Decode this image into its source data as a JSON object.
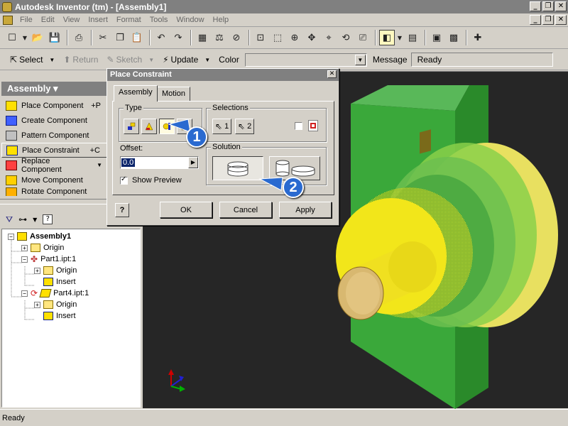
{
  "window": {
    "title": "Autodesk Inventor (tm) - [Assembly1]",
    "controls": [
      "_",
      "❐",
      "✕"
    ]
  },
  "menubar": {
    "items": [
      "File",
      "Edit",
      "View",
      "Insert",
      "Format",
      "Tools",
      "Window",
      "Help"
    ]
  },
  "toolbar": {
    "icons": [
      "new-icon",
      "open-icon",
      "save-icon",
      "print-icon",
      "cut-icon",
      "copy-icon",
      "paste-icon",
      "undo-icon",
      "redo-icon"
    ]
  },
  "command_bar": {
    "select_label": "Select",
    "return_label": "Return",
    "sketch_label": "Sketch",
    "update_label": "Update",
    "color_label": "Color",
    "color_value": "",
    "message_label": "Message",
    "message_value": "Ready"
  },
  "panel": {
    "header": "Assembly ▾",
    "items": [
      {
        "label": "Place Component",
        "shortcut": "+P"
      },
      {
        "label": "Create Component",
        "shortcut": ""
      },
      {
        "label": "Pattern Component",
        "shortcut": ""
      },
      {
        "label": "Place Constraint",
        "shortcut": "+C"
      },
      {
        "label": "Replace Component",
        "shortcut": ""
      },
      {
        "label": "Move Component",
        "shortcut": ""
      },
      {
        "label": "Rotate Component",
        "shortcut": ""
      }
    ]
  },
  "tree": {
    "root": "Assembly1",
    "origin": "Origin",
    "part1": "Part1.ipt:1",
    "part1_origin": "Origin",
    "part1_insert": "Insert",
    "part4": "Part4.ipt:1",
    "part4_origin": "Origin",
    "part4_insert": "Insert"
  },
  "dialog": {
    "title": "Place Constraint",
    "tabs": [
      "Assembly",
      "Motion"
    ],
    "type_label": "Type",
    "selections_label": "Selections",
    "sel1": "1",
    "sel2": "2",
    "offset_label": "Offset:",
    "offset_value": "0.0",
    "solution_label": "Solution",
    "show_preview": "Show Preview",
    "ok": "OK",
    "cancel": "Cancel",
    "apply": "Apply",
    "help": "?"
  },
  "callouts": [
    "1",
    "2"
  ],
  "status": "Ready",
  "colors": {
    "viewport_bg": "#262626",
    "plate_green": "#3aa83a",
    "shaft_yellow": "#f2e61a",
    "callout_blue": "#2a6ad0"
  }
}
